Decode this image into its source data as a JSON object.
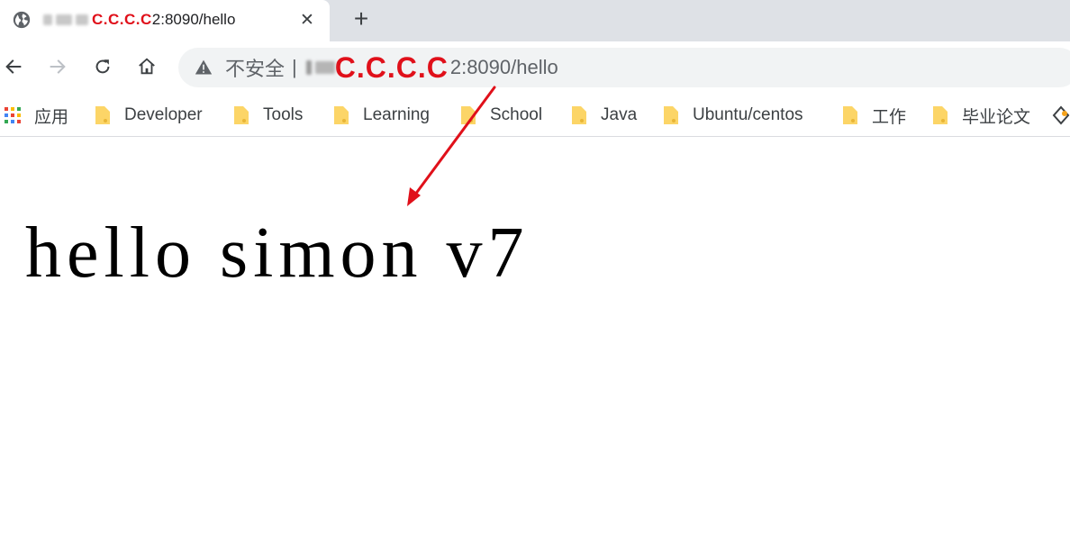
{
  "tab": {
    "title_redmark": "C.C.C.C",
    "title_suffix": "2:8090/hello",
    "close_glyph": "✕",
    "new_tab_glyph": "+"
  },
  "omnibox": {
    "security_label": "不安全",
    "separator": "|",
    "redmark": "C.C.C.C",
    "url_tail": "2:8090/hello"
  },
  "bookmarks": [
    {
      "label": "应用"
    },
    {
      "label": "Developer"
    },
    {
      "label": "Tools"
    },
    {
      "label": "Learning"
    },
    {
      "label": "School"
    },
    {
      "label": "Java"
    },
    {
      "label": "Ubuntu/centos"
    },
    {
      "label": "工作"
    },
    {
      "label": "毕业论文"
    }
  ],
  "content": {
    "text": "hello simon v7"
  },
  "colors": {
    "annotation_red": "#e0101a",
    "folder_yellow": "#fcd567"
  },
  "icons": {
    "tab_favicon": "globe-icon",
    "back": "arrow-left-icon",
    "forward": "arrow-right-icon",
    "reload": "reload-icon",
    "home": "home-icon",
    "security": "warning-triangle-icon",
    "apps": "apps-grid-icon",
    "folder": "folder-icon"
  }
}
